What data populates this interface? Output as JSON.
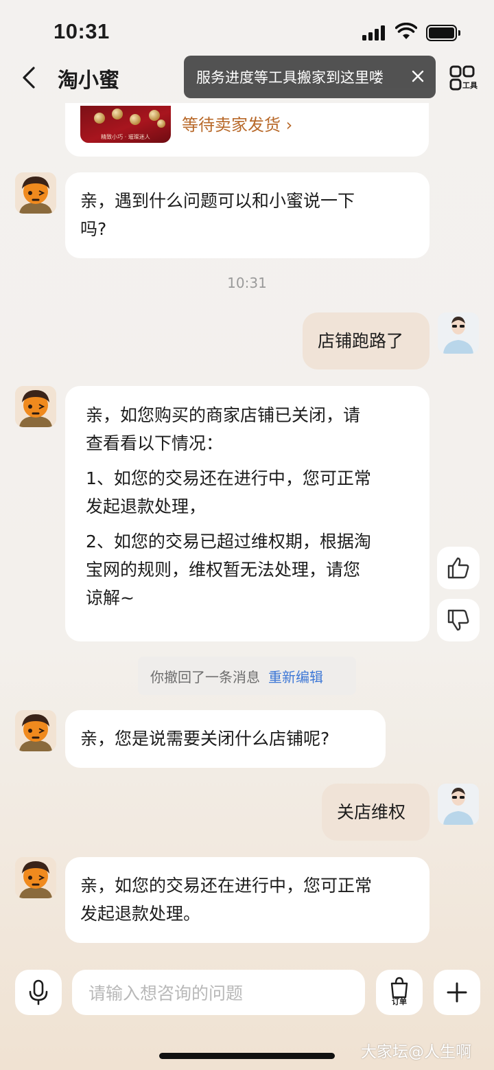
{
  "status_bar": {
    "time": "10:31"
  },
  "nav": {
    "title": "淘小蜜",
    "tooltip": "服务进度等工具搬家到这里喽",
    "tools_label": "工具"
  },
  "order_card": {
    "thumb_caption": "精致小巧 · 璀璨迷人",
    "status_link": "等待卖家发货 ›"
  },
  "messages": [
    {
      "from": "bot",
      "lines": [
        "亲，遇到什么问题可以和小蜜说一下",
        "吗?"
      ]
    },
    {
      "type": "time",
      "text": "10:31"
    },
    {
      "from": "user",
      "text": "店铺跑路了"
    },
    {
      "from": "bot",
      "paragraphs": [
        [
          "亲，如您购买的商家店铺已关闭，请",
          "查看看以下情况："
        ],
        [
          "1、如您的交易还在进行中，您可正常",
          "发起退款处理，"
        ],
        [
          "2、如您的交易已超过维权期，根据淘",
          "宝网的规则，维权暂无法处理，请您",
          "谅解~"
        ]
      ]
    },
    {
      "type": "recall",
      "text": "你撤回了一条消息",
      "action": "重新编辑"
    },
    {
      "from": "bot",
      "text": "亲，您是说需要关闭什么店铺呢?"
    },
    {
      "from": "user",
      "text": "关店维权"
    },
    {
      "from": "bot",
      "lines": [
        "亲，如您的交易还在进行中，您可正常",
        "发起退款处理。"
      ]
    }
  ],
  "input": {
    "placeholder": "请输入想咨询的问题",
    "order_label": "订单"
  },
  "watermark": "大家坛@人生啊",
  "colors": {
    "accent": "#b8692a",
    "link": "#3e78d6",
    "user_bubble": "#f0e3d7"
  }
}
